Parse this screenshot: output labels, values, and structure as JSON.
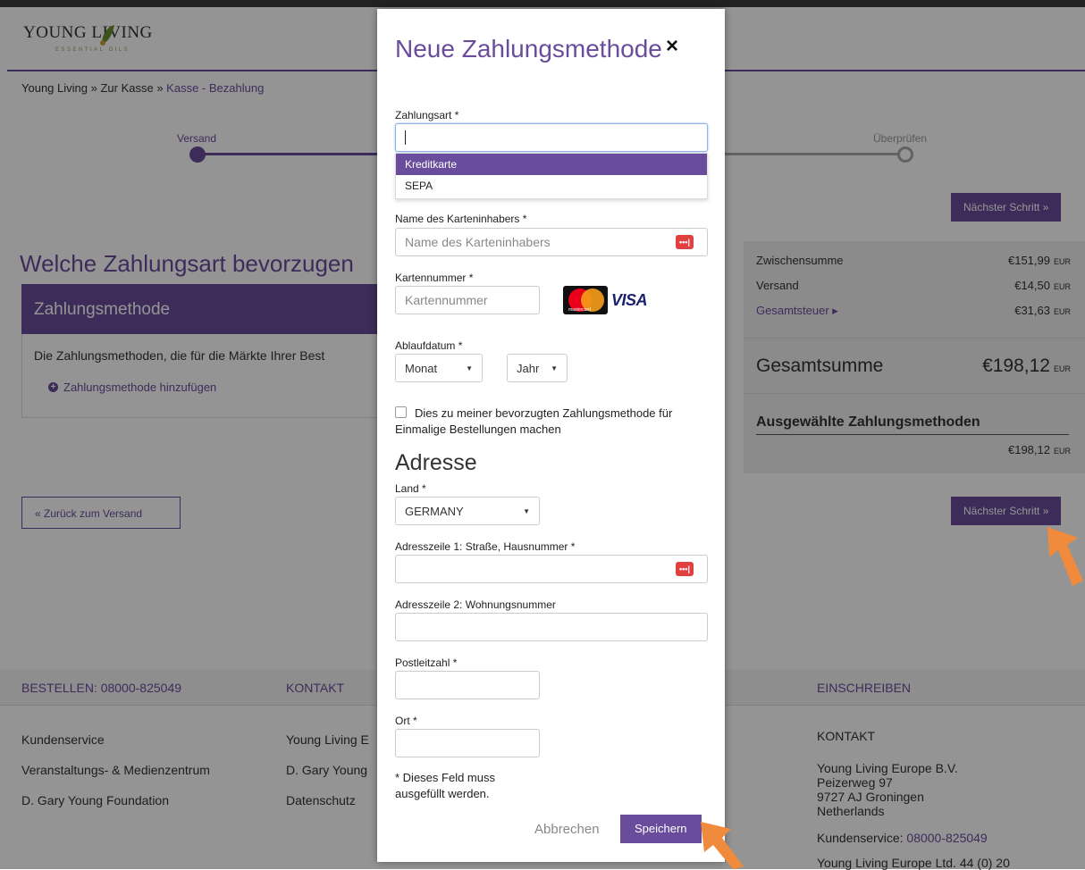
{
  "header": {
    "logo_text": "YOUNG LIVING",
    "logo_sub": "ESSENTIAL OILS"
  },
  "breadcrumb": {
    "home": "Young Living",
    "sep1": " » ",
    "checkout": "Zur Kasse",
    "sep2": " » ",
    "current": "Kasse - Bezahlung"
  },
  "steps": {
    "step1": "Versand",
    "step4": "Überprüfen"
  },
  "main": {
    "heading": "Welche Zahlungsart bevorzugen",
    "payment_panel_title": "Zahlungsmethode",
    "payment_desc": "Die Zahlungsmethoden, die für die Märkte Ihrer Best",
    "add_payment": "Zahlungsmethode hinzufügen",
    "back_button": "« Zurück zum Versand",
    "next_button": "Nächster Schritt »"
  },
  "summary": {
    "subtotal_label": "Zwischensumme",
    "subtotal_value": "€151,99",
    "shipping_label": "Versand",
    "shipping_value": "€14,50",
    "tax_label": "Gesamtsteuer ▸",
    "tax_value": "€31,63",
    "currency": "EUR",
    "total_label": "Gesamtsumme",
    "total_value": "€198,12",
    "selected_methods_label": "Ausgewählte Zahlungsmethoden",
    "selected_methods_value": "€198,12"
  },
  "footer": {
    "order_heading": "BESTELLEN: 08000-825049",
    "contact_heading": "KONTAKT",
    "signup_heading": "EINSCHREIBEN",
    "col1": [
      "Kundenservice",
      "Veranstaltungs- & Medienzentrum",
      "D. Gary Young Foundation"
    ],
    "col2": [
      "Young Living E",
      "D. Gary Young",
      "Datenschutz"
    ],
    "contact_title": "KONTAKT",
    "address": [
      "Young Living Europe B.V.",
      "Peizerweg 97",
      "9727 AJ Groningen",
      "Netherlands"
    ],
    "service_label": "Kundenservice:",
    "service_phone": "08000-825049",
    "bottom_partial": "Young Living Europe Ltd.",
    "bottom_partial2": "44 (0) 20"
  },
  "modal": {
    "title": "Neue Zahlungsmethode",
    "close_icon": "×",
    "payment_type_label": "Zahlungsart *",
    "payment_type_value": "",
    "payment_type_options": [
      "Kreditkarte",
      "SEPA"
    ],
    "cardholder_label": "Name des Karteninhabers *",
    "cardholder_placeholder": "Name des Karteninhabers",
    "card_number_label": "Kartennummer *",
    "card_number_placeholder": "Kartennummer",
    "mastercard_text": "mastercard",
    "visa_text": "VISA",
    "expiry_label": "Ablaufdatum *",
    "month_value": "Monat",
    "year_value": "Jahr",
    "default_checkbox_label": "Dies zu meiner bevorzugten Zahlungsmethode für Einmalige Bestellungen machen",
    "address_heading": "Adresse",
    "country_label": "Land *",
    "country_value": "GERMANY",
    "address1_label": "Adresszeile 1: Straße, Hausnummer *",
    "address2_label": "Adresszeile 2: Wohnungsnummer",
    "postal_label": "Postleitzahl *",
    "city_label": "Ort *",
    "required_note": "* Dieses Feld muss ausgefüllt werden.",
    "cancel_button": "Abbrechen",
    "save_button": "Speichern",
    "password_icon": "•••|"
  }
}
